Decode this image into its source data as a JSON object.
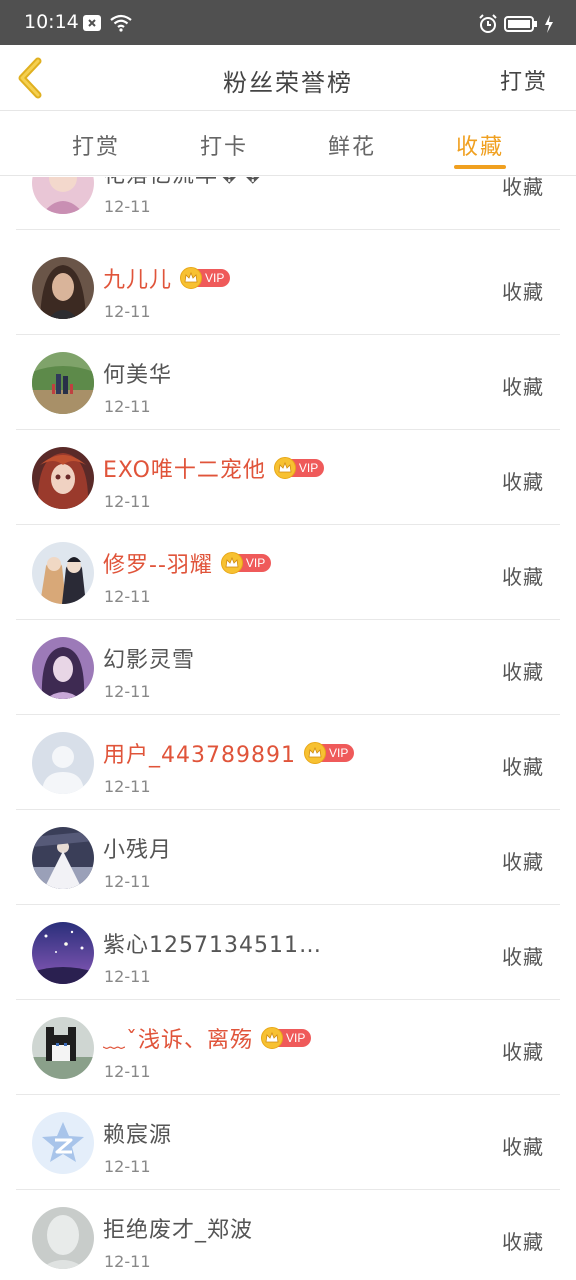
{
  "status_bar": {
    "time": "10:14"
  },
  "header": {
    "title": "粉丝荣誉榜",
    "action_label": "打赏"
  },
  "tabs": [
    {
      "label": "打赏",
      "active": false
    },
    {
      "label": "打卡",
      "active": false
    },
    {
      "label": "鲜花",
      "active": false
    },
    {
      "label": "收藏",
      "active": true
    }
  ],
  "colors": {
    "accent": "#f0a020",
    "vip_name": "#e0543a",
    "status_bar": "#505050"
  },
  "vip_label": "VIP",
  "rows": [
    {
      "name": "花落忆流年��",
      "date": "12-11",
      "action": "收藏",
      "vip": false,
      "avatar": "avatar-pink-girl"
    },
    {
      "name": "九儿儿",
      "date": "12-11",
      "action": "收藏",
      "vip": true,
      "avatar": "avatar-girl-portrait"
    },
    {
      "name": "何美华",
      "date": "12-11",
      "action": "收藏",
      "vip": false,
      "avatar": "avatar-family-walk"
    },
    {
      "name": "EXO唯十二宠他",
      "date": "12-11",
      "action": "收藏",
      "vip": true,
      "avatar": "avatar-anime-girl"
    },
    {
      "name": "修罗--羽耀",
      "date": "12-11",
      "action": "收藏",
      "vip": true,
      "avatar": "avatar-anime-couple"
    },
    {
      "name": "幻影灵雪",
      "date": "12-11",
      "action": "收藏",
      "vip": false,
      "avatar": "avatar-purple-girl"
    },
    {
      "name": "用户_443789891",
      "date": "12-11",
      "action": "收藏",
      "vip": true,
      "avatar": "avatar-default-user"
    },
    {
      "name": "小残月",
      "date": "12-11",
      "action": "收藏",
      "vip": false,
      "avatar": "avatar-bride"
    },
    {
      "name": "紫心1257134511…",
      "date": "12-11",
      "action": "收藏",
      "vip": false,
      "avatar": "avatar-starry-sky"
    },
    {
      "name": "﹏ˇ浅诉、离殇",
      "date": "12-11",
      "action": "收藏",
      "vip": true,
      "avatar": "avatar-husky"
    },
    {
      "name": "赖宸源",
      "date": "12-11",
      "action": "收藏",
      "vip": false,
      "avatar": "avatar-qzone-logo"
    },
    {
      "name": "拒绝废才_郑波",
      "date": "12-11",
      "action": "收藏",
      "vip": false,
      "avatar": "avatar-grey-user"
    }
  ]
}
